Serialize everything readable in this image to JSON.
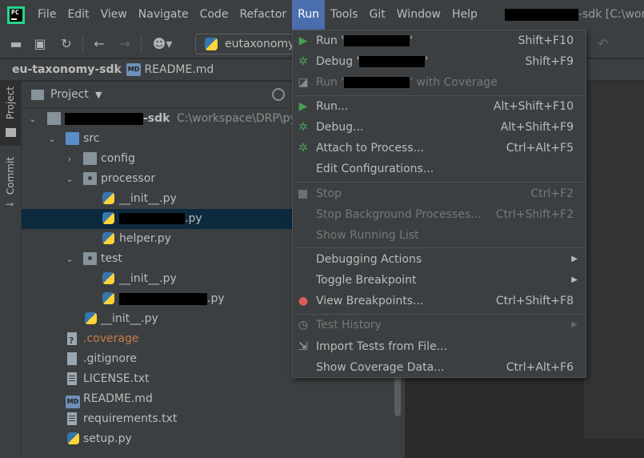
{
  "menubar": {
    "items": [
      "File",
      "Edit",
      "View",
      "Navigate",
      "Code",
      "Refactor",
      "Run",
      "Tools",
      "Git",
      "Window",
      "Help"
    ],
    "active": "Run",
    "title_suffix": "-sdk [C:\\work"
  },
  "toolbar": {
    "run_config_label": "eutaxonomy"
  },
  "breadcrumb": {
    "root": "eu-taxonomy-sdk",
    "file": "README.md",
    "file_icon_text": "MD"
  },
  "side_tabs": {
    "project": "Project",
    "commit": "Commit"
  },
  "project_panel": {
    "header": "Project",
    "root_suffix": "-sdk",
    "root_path": "C:\\workspace\\DRP\\pyth",
    "tree": {
      "src": "src",
      "config": "config",
      "processor": "processor",
      "init1": "__init__.py",
      "redacted_py": ".py",
      "helper": "helper.py",
      "test": "test",
      "init2": "__init__.py",
      "redacted_py2": ".py",
      "init3": "__init__.py",
      "coverage": ".coverage",
      "gitignore": ".gitignore",
      "license": "LICENSE.txt",
      "readme": "README.md",
      "requirements": "requirements.txt",
      "setup": "setup.py"
    }
  },
  "run_menu": {
    "run_prefix": "Run '",
    "run_suffix": "'",
    "run_shortcut": "Shift+F10",
    "debug_prefix": "Debug '",
    "debug_suffix": "'",
    "debug_shortcut": "Shift+F9",
    "cov_prefix": "Run '",
    "cov_suffix": "' with Coverage",
    "run_dots": "Run...",
    "run_dots_shortcut": "Alt+Shift+F10",
    "debug_dots": "Debug...",
    "debug_dots_shortcut": "Alt+Shift+F9",
    "attach": "Attach to Process...",
    "attach_shortcut": "Ctrl+Alt+F5",
    "edit_configs": "Edit Configurations...",
    "stop": "Stop",
    "stop_shortcut": "Ctrl+F2",
    "stop_bg": "Stop Background Processes...",
    "stop_bg_shortcut": "Ctrl+Shift+F2",
    "show_running": "Show Running List",
    "debugging_actions": "Debugging Actions",
    "toggle_bp": "Toggle Breakpoint",
    "view_bp": "View Breakpoints...",
    "view_bp_shortcut": "Ctrl+Shift+F8",
    "test_history": "Test History",
    "import_tests": "Import Tests from File...",
    "show_cov": "Show Coverage Data...",
    "show_cov_shortcut": "Ctrl+Alt+F6"
  }
}
